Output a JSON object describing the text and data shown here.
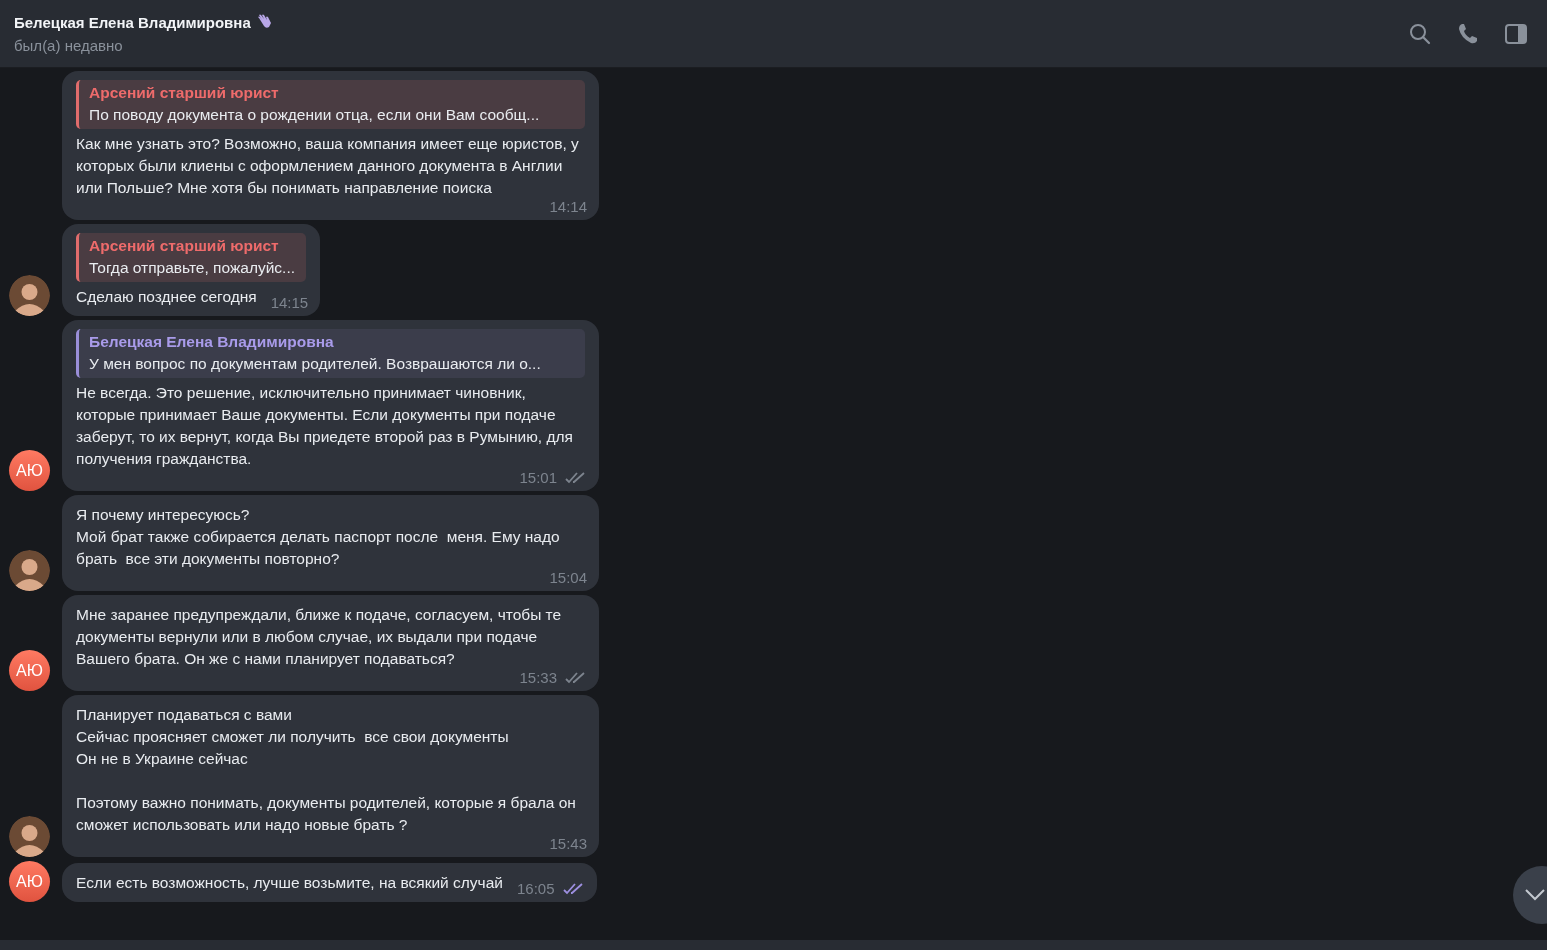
{
  "header": {
    "title": "Белецкая Елена Владимировна",
    "status": "был(а) недавно"
  },
  "messages": [
    {
      "text": "Как мне узнать это? Возможно, ваша компания имеет еще юристов, у которых были клиены с оформлением данного документа в Англии или Польше? Мне хотя бы понимать направление поиска",
      "time": "14:14",
      "outgoing": false,
      "reply": {
        "kind": "red",
        "author": "Арсений старший юрист",
        "text": "По поводу документа о рождении отца, если они Вам сообщ..."
      }
    },
    {
      "text": "Сделаю позднее сегодня",
      "time": "14:15",
      "outgoing": false,
      "avatar": {
        "kind": "photo"
      },
      "reply": {
        "kind": "red",
        "author": "Арсений старший юрист",
        "text": "Тогда отправьте, пожалуйс..."
      }
    },
    {
      "text": "Не всегда. Это решение, исключительно принимает чиновник, которые принимает Ваше документы. Если документы при подаче заберут, то их вернут, когда Вы приедете второй раз в Румынию, для получения гражданства.",
      "time": "15:01",
      "outgoing": true,
      "highlighted": false,
      "avatar": {
        "kind": "initials",
        "text": "АЮ"
      },
      "reply": {
        "kind": "violet",
        "author": "Белецкая Елена Владимировна",
        "text": "У мен вопрос по документам родителей. Возврашаются ли о..."
      }
    },
    {
      "text": "Я почему интересуюсь?\nМой брат также собирается делать паспорт после  меня. Ему надо брать  все эти документы повторно?",
      "time": "15:04",
      "outgoing": false,
      "avatar": {
        "kind": "photo"
      }
    },
    {
      "text": "Мне заранее предупреждали, ближе к подаче, согласуем, чтобы те документы вернули или в любом случае, их выдали при подаче Вашего брата. Он же с нами планирует подаваться?",
      "time": "15:33",
      "outgoing": true,
      "highlighted": false,
      "avatar": {
        "kind": "initials",
        "text": "АЮ"
      }
    },
    {
      "text": "Планирует подаваться с вами\nСейчас проясняет сможет ли получить  все свои документы\nОн не в Украине сейчас\n\nПоэтому важно понимать, документы родителей, которые я брала он сможет использовать или надо новые брать ?",
      "time": "15:43",
      "outgoing": false,
      "avatar": {
        "kind": "photo"
      }
    },
    {
      "text": "Если есть возможность, лучше возьмите, на всякий случай",
      "time": "16:05",
      "outgoing": true,
      "highlighted": true,
      "avatar": {
        "kind": "initials",
        "text": "АЮ"
      }
    }
  ]
}
